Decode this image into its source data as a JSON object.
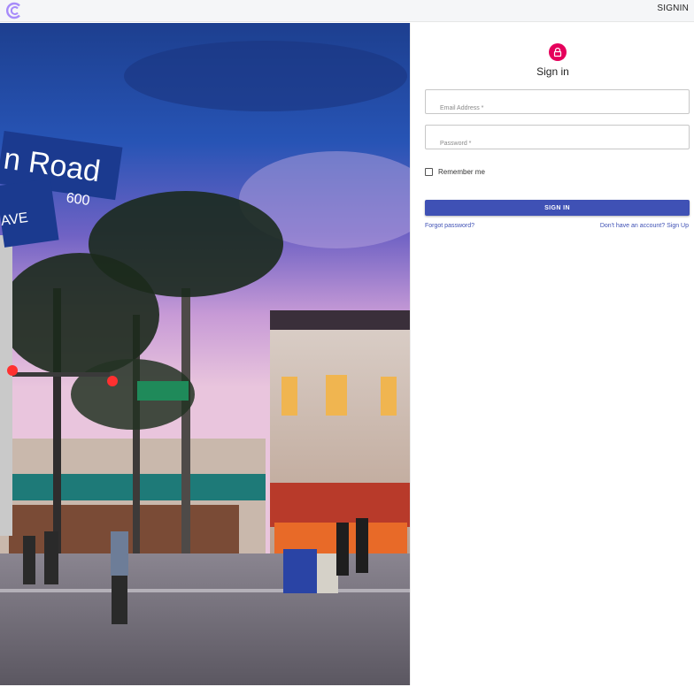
{
  "header": {
    "logo_icon": "c-logo-icon",
    "signin_label": "SIGNIN"
  },
  "form": {
    "title": "Sign in",
    "lock_icon": "lock-icon",
    "email_label": "Email Address *",
    "email_value": "",
    "password_label": "Password *",
    "password_value": "",
    "remember_label": "Remember me",
    "remember_checked": false,
    "submit_label": "SIGN IN",
    "forgot_link": "Forgot password?",
    "signup_link": "Don't have an account? Sign Up"
  },
  "colors": {
    "accent": "#3f51b5",
    "lock_avatar": "#e5005b",
    "logo": "#a78bfa"
  }
}
